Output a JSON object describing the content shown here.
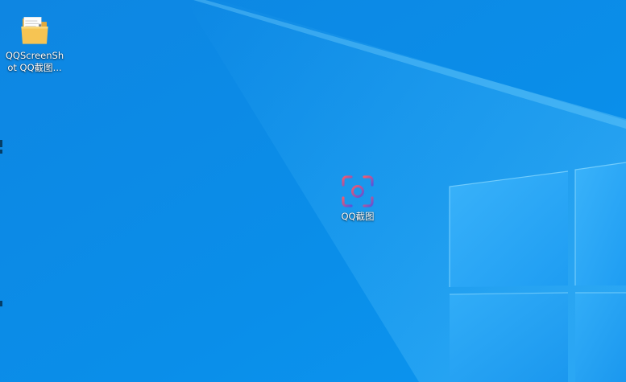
{
  "desktop": {
    "icons": [
      {
        "label_line1": "QQScreenSh",
        "label_line2": "ot QQ截图...",
        "icon": "folder-icon"
      },
      {
        "label": "QQ截图",
        "icon": "qq-screenshot-app-icon"
      }
    ],
    "colors": {
      "background": "#0b8ae6",
      "window_logo_pane": "#2aa7f5",
      "folder_yellow": "#f5c451",
      "qq_icon_gradient_start": "#f05a6e",
      "qq_icon_gradient_end": "#5a55d9"
    }
  }
}
